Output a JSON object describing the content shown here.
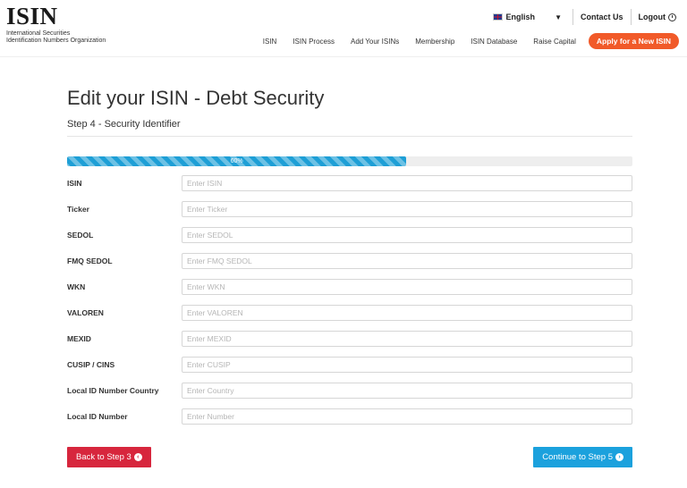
{
  "brand": {
    "logo": "ISIN",
    "subtitle_line1": "International Securities",
    "subtitle_line2": "Identification Numbers Organization"
  },
  "topbar": {
    "language": "English",
    "contact": "Contact Us",
    "logout": "Logout"
  },
  "nav": {
    "items": [
      "ISIN",
      "ISIN Process",
      "Add Your ISINs",
      "Membership",
      "ISIN Database",
      "Raise Capital"
    ],
    "cta": "Apply for a New ISIN"
  },
  "page": {
    "title": "Edit your ISIN - Debt Security",
    "step": "Step 4 - Security Identifier"
  },
  "progress": {
    "value": 60,
    "label": "60%"
  },
  "form": {
    "fields": [
      {
        "label": "ISIN",
        "placeholder": "Enter ISIN",
        "value": ""
      },
      {
        "label": "Ticker",
        "placeholder": "Enter Ticker",
        "value": ""
      },
      {
        "label": "SEDOL",
        "placeholder": "Enter SEDOL",
        "value": ""
      },
      {
        "label": "FMQ SEDOL",
        "placeholder": "Enter FMQ SEDOL",
        "value": ""
      },
      {
        "label": "WKN",
        "placeholder": "Enter WKN",
        "value": ""
      },
      {
        "label": "VALOREN",
        "placeholder": "Enter VALOREN",
        "value": ""
      },
      {
        "label": "MEXID",
        "placeholder": "Enter MEXID",
        "value": ""
      },
      {
        "label": "CUSIP / CINS",
        "placeholder": "Enter CUSIP",
        "value": ""
      },
      {
        "label": "Local ID Number Country",
        "placeholder": "Enter Country",
        "value": ""
      },
      {
        "label": "Local ID Number",
        "placeholder": "Enter Number",
        "value": ""
      }
    ]
  },
  "actions": {
    "back": "Back to Step 3",
    "continue": "Continue to Step 5"
  },
  "icons": {
    "flag": "uk-flag-icon",
    "caret": "caret-down-icon",
    "logout": "power-icon",
    "back": "arrow-circle-left-icon",
    "continue": "arrow-circle-right-icon"
  },
  "colors": {
    "accent_orange": "#f15a29",
    "progress_blue": "#1e9fd6",
    "back_red": "#d7263d",
    "continue_blue": "#1ba1dd"
  }
}
